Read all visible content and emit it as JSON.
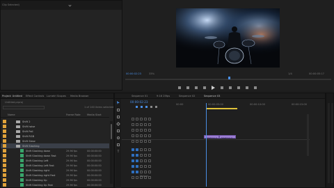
{
  "source": {
    "message": "Clip Selected)"
  },
  "program": {
    "timecode": "00:00:02:23",
    "zoom": "33%",
    "resolution": "1/4",
    "duration": "00:00:05:17"
  },
  "project": {
    "tabs": [
      "Project: Untitled",
      "Effect Controls",
      "Lumetri Scopes",
      "Media Browser"
    ],
    "path": "Untitled.prproj",
    "item_count": "1 of 140 items selected",
    "columns": {
      "name": "Name",
      "frame_rate": "Frame Rate",
      "media_start": "Media Start"
    },
    "items": [
      {
        "type": "folder",
        "name": "Shift 2",
        "fr": "",
        "ms": ""
      },
      {
        "type": "folder",
        "name": "Shift Iwise",
        "fr": "",
        "ms": ""
      },
      {
        "type": "folder",
        "name": "Shift Pall",
        "fr": "",
        "ms": ""
      },
      {
        "type": "folder",
        "name": "Shift RGB",
        "fr": "",
        "ms": ""
      },
      {
        "type": "folder",
        "name": "Shift Skew",
        "fr": "",
        "ms": ""
      },
      {
        "type": "folder",
        "name": "Shift Slashing",
        "fr": "",
        "ms": ""
      },
      {
        "type": "clip",
        "name": "Shift Slashing down",
        "fr": "29.96 fps",
        "ms": "00:00:00:00"
      },
      {
        "type": "clip",
        "name": "Shift Slashing down Fast",
        "fr": "29.96 fps",
        "ms": "00:00:00:00"
      },
      {
        "type": "clip",
        "name": "Shift Slashing Left",
        "fr": "29.96 fps",
        "ms": "00:00:00:00"
      },
      {
        "type": "clip",
        "name": "Shift Slashing Left Fast",
        "fr": "29.96 fps",
        "ms": "00:00:00:00"
      },
      {
        "type": "clip",
        "name": "Shift Slashing right",
        "fr": "29.96 fps",
        "ms": "00:00:00:00"
      },
      {
        "type": "clip",
        "name": "Shift Slashing right Fast",
        "fr": "29.96 fps",
        "ms": "00:00:00:00"
      },
      {
        "type": "clip",
        "name": "Shift Slashing Up",
        "fr": "29.96 fps",
        "ms": "00:00:00:00"
      },
      {
        "type": "clip",
        "name": "Shift Slashing Up Fast",
        "fr": "29.96 fps",
        "ms": "00:00:00:00"
      }
    ]
  },
  "timeline": {
    "tabs": [
      "Sequence 01",
      "9:16 25fps",
      "Sequence 02",
      "Sequence 03"
    ],
    "timecode": "00:00:02:23",
    "ruler": [
      "00:00",
      "00:00:05:00",
      "00:00:10:00",
      "00:00:15:00"
    ],
    "clips": [
      "Slashing d",
      "Slashing d"
    ],
    "master": "Master"
  }
}
